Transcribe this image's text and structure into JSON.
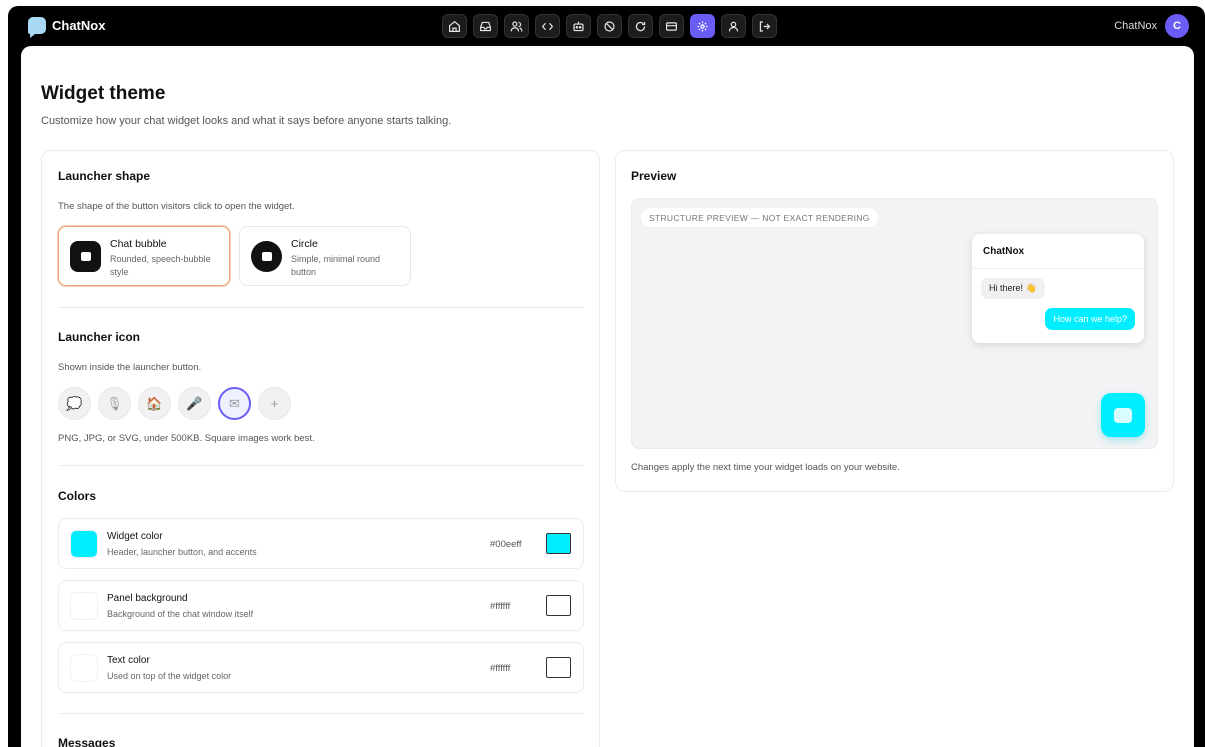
{
  "brand": {
    "name": "ChatNox"
  },
  "nav": {
    "icons": [
      "home-icon",
      "inbox-icon",
      "users-icon",
      "code-icon",
      "robot-icon",
      "block-icon",
      "refresh-icon",
      "billing-icon",
      "settings-icon",
      "profile-icon",
      "logout-icon"
    ],
    "active": "settings-icon"
  },
  "user": {
    "name": "ChatNox",
    "initial": "C"
  },
  "page": {
    "title": "Widget theme",
    "subtitle": "Customize how your chat widget looks and what it says before anyone starts talking."
  },
  "launcher_shape": {
    "title": "Launcher shape",
    "desc": "The shape of the button visitors click to open the widget.",
    "options": [
      {
        "name": "Chat bubble",
        "desc": "Rounded, speech-bubble style",
        "selected": true
      },
      {
        "name": "Circle",
        "desc": "Simple, minimal round button",
        "selected": false
      }
    ]
  },
  "launcher_icon": {
    "title": "Launcher icon",
    "desc": "Shown inside the launcher button.",
    "options": [
      {
        "name": "speech-bubble-icon",
        "glyph": "💭"
      },
      {
        "name": "microphone-stand-icon",
        "glyph": "🎙"
      },
      {
        "name": "house-icon",
        "glyph": "🏠"
      },
      {
        "name": "microphone-icon",
        "glyph": "🎤"
      },
      {
        "name": "envelope-icon",
        "glyph": "✉",
        "selected": true
      },
      {
        "name": "add-icon",
        "glyph": "+"
      }
    ],
    "hint": "PNG, JPG, or SVG, under 500KB. Square images work best."
  },
  "colors": {
    "title": "Colors",
    "rows": [
      {
        "name": "Widget color",
        "desc": "Header, launcher button, and accents",
        "hex": "#00eeff",
        "value": "#00eeff"
      },
      {
        "name": "Panel background",
        "desc": "Background of the chat window itself",
        "hex": "#ffffff",
        "value": "#ffffff"
      },
      {
        "name": "Text color",
        "desc": "Used on top of the widget color",
        "hex": "#ffffff",
        "value": "#ffffff"
      }
    ]
  },
  "messages": {
    "title": "Messages"
  },
  "preview": {
    "title": "Preview",
    "badge": "STRUCTURE PREVIEW — NOT EXACT RENDERING",
    "chat_title": "ChatNox",
    "greeting": "Hi there! 👋",
    "reply": "How can we help?",
    "note": "Changes apply the next time your widget loads on your website."
  }
}
